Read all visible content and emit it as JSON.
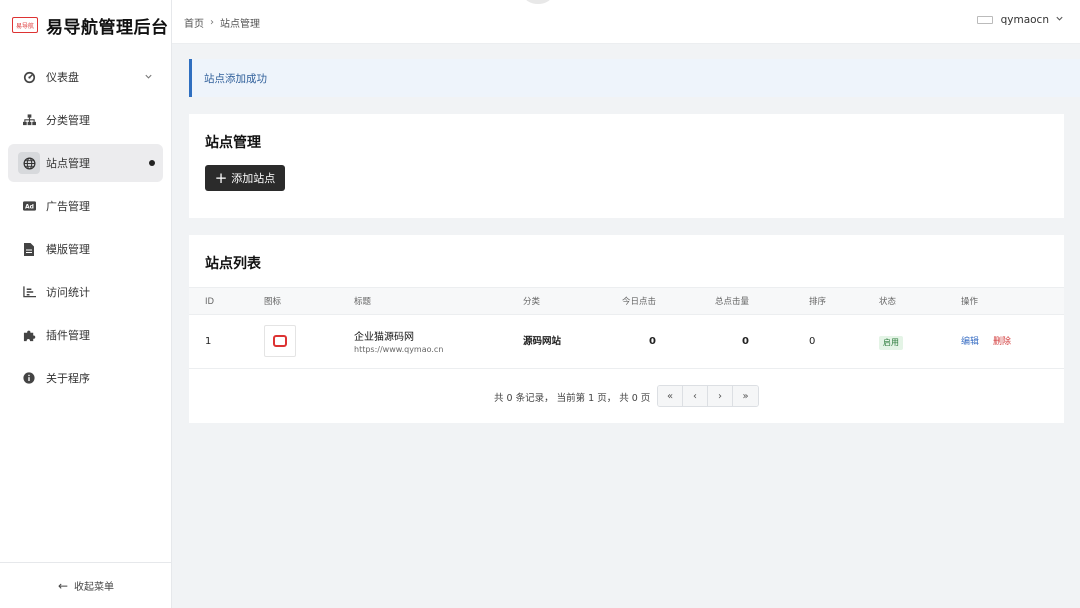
{
  "app": {
    "title": "易导航管理后台",
    "logo_text": "易导航"
  },
  "sidebar": {
    "items": [
      {
        "label": "仪表盘",
        "icon": "dashboard-icon"
      },
      {
        "label": "分类管理",
        "icon": "sitemap-icon"
      },
      {
        "label": "站点管理",
        "icon": "globe-icon"
      },
      {
        "label": "广告管理",
        "icon": "ad-icon"
      },
      {
        "label": "模版管理",
        "icon": "file-icon"
      },
      {
        "label": "访问统计",
        "icon": "stats-icon"
      },
      {
        "label": "插件管理",
        "icon": "puzzle-icon"
      },
      {
        "label": "关于程序",
        "icon": "info-icon"
      }
    ],
    "collapse_label": "收起菜单",
    "active_index": 2
  },
  "topbar": {
    "breadcrumb": [
      "首页",
      "站点管理"
    ],
    "username": "qymaocn"
  },
  "alert": {
    "message": "站点添加成功"
  },
  "manage_card": {
    "title": "站点管理",
    "add_button": "添加站点"
  },
  "list_card": {
    "title": "站点列表",
    "columns": [
      "ID",
      "图标",
      "标题",
      "分类",
      "今日点击",
      "总点击量",
      "排序",
      "状态",
      "操作"
    ],
    "rows": [
      {
        "id": "1",
        "title": "企业猫源码网",
        "url": "https://www.qymao.cn",
        "category": "源码网站",
        "today_clicks": "0",
        "total_clicks": "0",
        "sort": "0",
        "status": "启用",
        "edit": "编辑",
        "delete": "删除"
      }
    ]
  },
  "pagination": {
    "summary": "共 0 条记录， 当前第 1 页， 共 0 页",
    "buttons": [
      "«",
      "‹",
      "›",
      "»"
    ]
  },
  "colors": {
    "accent": "#2f6fc0",
    "primary_button": "#2b2b2b",
    "danger": "#d23b3b",
    "success_bg": "#e4f4e6"
  }
}
